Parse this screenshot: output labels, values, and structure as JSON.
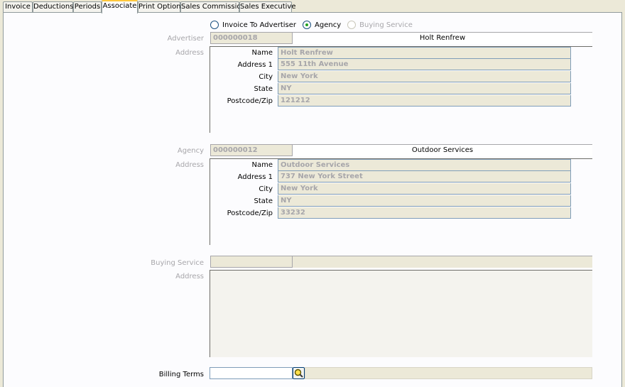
{
  "tabs": [
    {
      "label": "Invoice",
      "active": false
    },
    {
      "label": "Deductions",
      "active": false
    },
    {
      "label": "Periods",
      "active": false
    },
    {
      "label": "Associate",
      "active": true
    },
    {
      "label": "Print Options",
      "active": false
    },
    {
      "label": "Sales Commission",
      "active": false
    },
    {
      "label": "Sales Executive",
      "active": false
    }
  ],
  "invoice_to": {
    "options": [
      {
        "label": "Invoice To Advertiser",
        "selected": false,
        "enabled": true
      },
      {
        "label": "Agency",
        "selected": true,
        "enabled": true
      },
      {
        "label": "Buying Service",
        "selected": false,
        "enabled": false
      }
    ]
  },
  "advertiser": {
    "label": "Advertiser",
    "code": "000000018",
    "name_display": "Holt Renfrew",
    "address_label": "Address",
    "fields": [
      {
        "label": "Name",
        "value": "Holt Renfrew"
      },
      {
        "label": "Address 1",
        "value": "555 11th Avenue"
      },
      {
        "label": "City",
        "value": "New York"
      },
      {
        "label": "State",
        "value": "NY"
      },
      {
        "label": "Postcode/Zip",
        "value": "121212"
      }
    ]
  },
  "agency": {
    "label": "Agency",
    "code": "000000012",
    "name_display": "Outdoor Services",
    "address_label": "Address",
    "fields": [
      {
        "label": "Name",
        "value": "Outdoor Services"
      },
      {
        "label": "Address 1",
        "value": "737 New York Street"
      },
      {
        "label": "City",
        "value": "New York"
      },
      {
        "label": "State",
        "value": "NY"
      },
      {
        "label": "Postcode/Zip",
        "value": "33232"
      }
    ]
  },
  "buying_service": {
    "label": "Buying Service",
    "code": "",
    "name_display": "",
    "address_label": "Address"
  },
  "billing_terms": {
    "label": "Billing Terms",
    "value": "",
    "description": "",
    "lookup_icon": "search-icon"
  },
  "colors": {
    "tab_active_accent": "#ffc83c",
    "radio_selected": "#21a121",
    "field_border": "#7f9db9",
    "disabled_text": "#a7a6aa"
  }
}
